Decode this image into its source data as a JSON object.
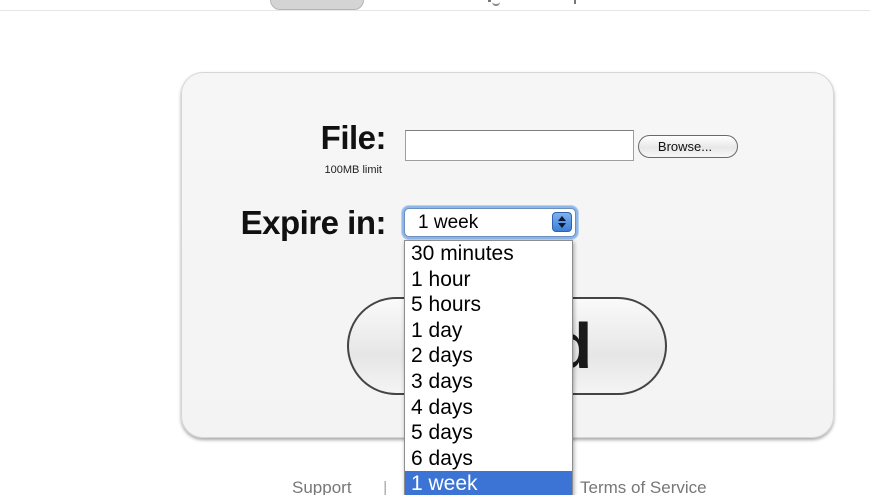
{
  "form": {
    "file_label": "File:",
    "file_limit": "100MB limit",
    "browse_label": "Browse...",
    "expire_label": "Expire in:",
    "expire_selected": "1 week",
    "expire_options": [
      "30 minutes",
      "1 hour",
      "5 hours",
      "1 day",
      "2 days",
      "3 days",
      "4 days",
      "5 days",
      "6 days",
      "1 week"
    ],
    "upload_visible_text": "d"
  },
  "footer": {
    "support": "Support",
    "separator": "|",
    "terms": "Terms of Service"
  },
  "colors": {
    "selection": "#3b74d4",
    "focus_ring": "#8fb6e8",
    "panel_bg": "#f5f5f5"
  },
  "icons": {
    "select_arrows": "up-down-arrows-icon"
  }
}
